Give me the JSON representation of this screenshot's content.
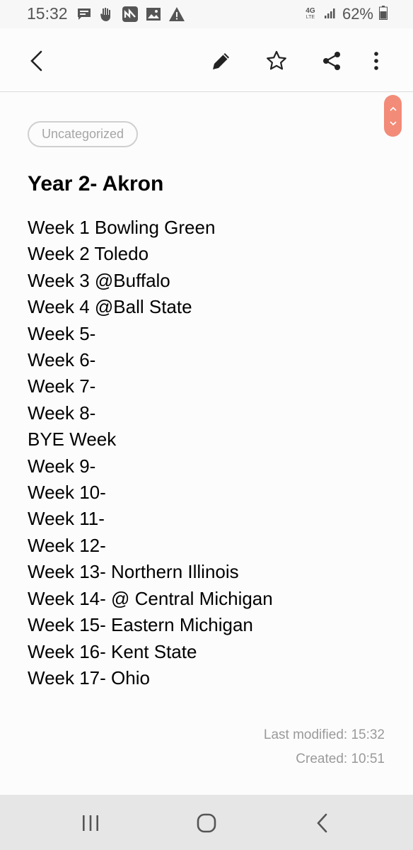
{
  "status_bar": {
    "time": "15:32",
    "network": "4G",
    "network_sub": "LTE",
    "battery_percent": "62%",
    "notification_icons": [
      "chat-bubble-icon",
      "hand-icon",
      "app-n-icon",
      "image-icon",
      "warning-icon"
    ]
  },
  "toolbar": {
    "icons": [
      "back-arrow-icon",
      "pencil-icon",
      "star-outline-icon",
      "share-icon",
      "more-vert-icon"
    ]
  },
  "note": {
    "category": "Uncategorized",
    "title": "Year 2- Akron",
    "lines": [
      "Week 1 Bowling Green",
      "Week 2 Toledo",
      "Week 3 @Buffalo",
      "Week 4 @Ball State",
      "Week 5-",
      "Week 6-",
      "Week 7-",
      "Week 8-",
      "BYE Week",
      "Week 9-",
      "Week 10-",
      "Week 11-",
      "Week 12-",
      "Week 13- Northern Illinois",
      "Week 14- @ Central Michigan",
      "Week 15- Eastern Michigan",
      "Week 16- Kent State",
      "Week 17- Ohio"
    ],
    "last_modified": "Last modified: 15:32",
    "created": "Created: 10:51"
  },
  "nav_bar": {
    "icons": [
      "recents-icon",
      "home-icon",
      "back-icon"
    ]
  },
  "colors": {
    "accent": "#f28b78",
    "chip_border": "#cfcfcf",
    "meta_text": "#9a9a9a"
  }
}
